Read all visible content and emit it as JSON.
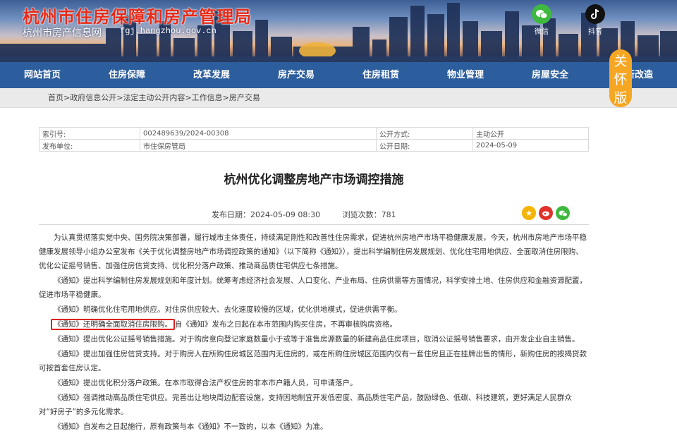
{
  "header": {
    "site_title": "杭州市住房保障和房产管理局",
    "site_subtitle": "杭州市房产信息网",
    "site_url": "fgj.hangzhou.gov.cn",
    "social": [
      {
        "icon": "wechat-icon",
        "label": "微信",
        "color": "#3fb83f"
      },
      {
        "icon": "douyin-icon",
        "label": "抖音",
        "color": "#111111"
      }
    ]
  },
  "nav": {
    "items": [
      "网站首页",
      "住房保障",
      "改革发展",
      "房产交易",
      "住房租赁",
      "物业管理",
      "房屋安全",
      "更新改造"
    ]
  },
  "care_mode": {
    "label": [
      "关",
      "怀",
      "版"
    ],
    "color": "#f5a623"
  },
  "breadcrumb": [
    "首页",
    "政府信息公开",
    "法定主动公开内容",
    "工作信息",
    "房产交易"
  ],
  "meta": {
    "index_label": "索引号:",
    "index_value": "002489639/2024-00308",
    "method_label": "公开方式:",
    "method_value": "主动公开",
    "unit_label": "发布单位:",
    "unit_value": "市住保房管局",
    "date_label": "公开日期:",
    "date_value": "2024-05-09"
  },
  "article": {
    "title": "杭州优化调整房地产市场调控措施",
    "publish_label": "发布日期：2024-05-09 08:30",
    "views_label": "浏览次数：781",
    "share": [
      {
        "icon": "star-icon",
        "color": "#f5b400"
      },
      {
        "icon": "weibo-icon",
        "color": "#e0322b"
      },
      {
        "icon": "wechat-share-icon",
        "color": "#3fb83f"
      }
    ],
    "paragraphs": [
      "为认真贯彻落实党中央、国务院决策部署，履行城市主体责任，持续满足刚性和改善性住房需求，促进杭州房地产市场平稳健康发展，今天，杭州市房地产市场平稳健康发展领导小组办公室发布《关于优化调整房地产市场调控政策的通知》（以下简称《通知》），提出科学编制住房发展规划、优化住宅用地供应、全面取消住房限购、优化公证摇号销售、加强住房信贷支持、优化积分落户政策、推动商品质住宅供应七条措施。",
      "《通知》提出科学编制住房发展规划和年度计划。统筹考虑经济社会发展、人口变化、产业布局、住房供需等方面情况，科学安排土地、住房供应和金融资源配置，促进市场平稳健康。",
      "《通知》明确优化住宅用地供应。对住房供应较大、去化速度较慢的区域，优化供地模式，促进供需平衡。",
      "《通知》提出优化公证摇号销售措施。对于购房意向登记家庭数量小于或等于准售房源数量的新建商品住房项目，取消公证摇号销售要求，由开发企业自主销售。",
      "《通知》提出加强住房信贷支持。对于购房人在所购住房城区范围内无住房的，或在所购住房城区范围内仅有一套住房且正在挂牌出售的情形，新购住房的按揭贷款可按首套住房认定。",
      "《通知》提出优化积分落户政策。在本市取得合法产权住房的非本市户籍人员，可申请落户。",
      "《通知》强调推动高品质住宅供应。完善出让地块周边配套设施，支持因地制宜开发低密度、高品质住宅产品，鼓励绿色、低碳、科技建筑，更好满足人民群众对“好房子”的多元化需求。",
      "《通知》自发布之日起施行，原有政策与本《通知》不一致的，以本《通知》为准。"
    ],
    "highlight": {
      "boxed": "《通知》还明确全面取消住房限购。",
      "rest": "自《通知》发布之日起在本市范围内购买住房，不再审核购房资格。"
    }
  }
}
